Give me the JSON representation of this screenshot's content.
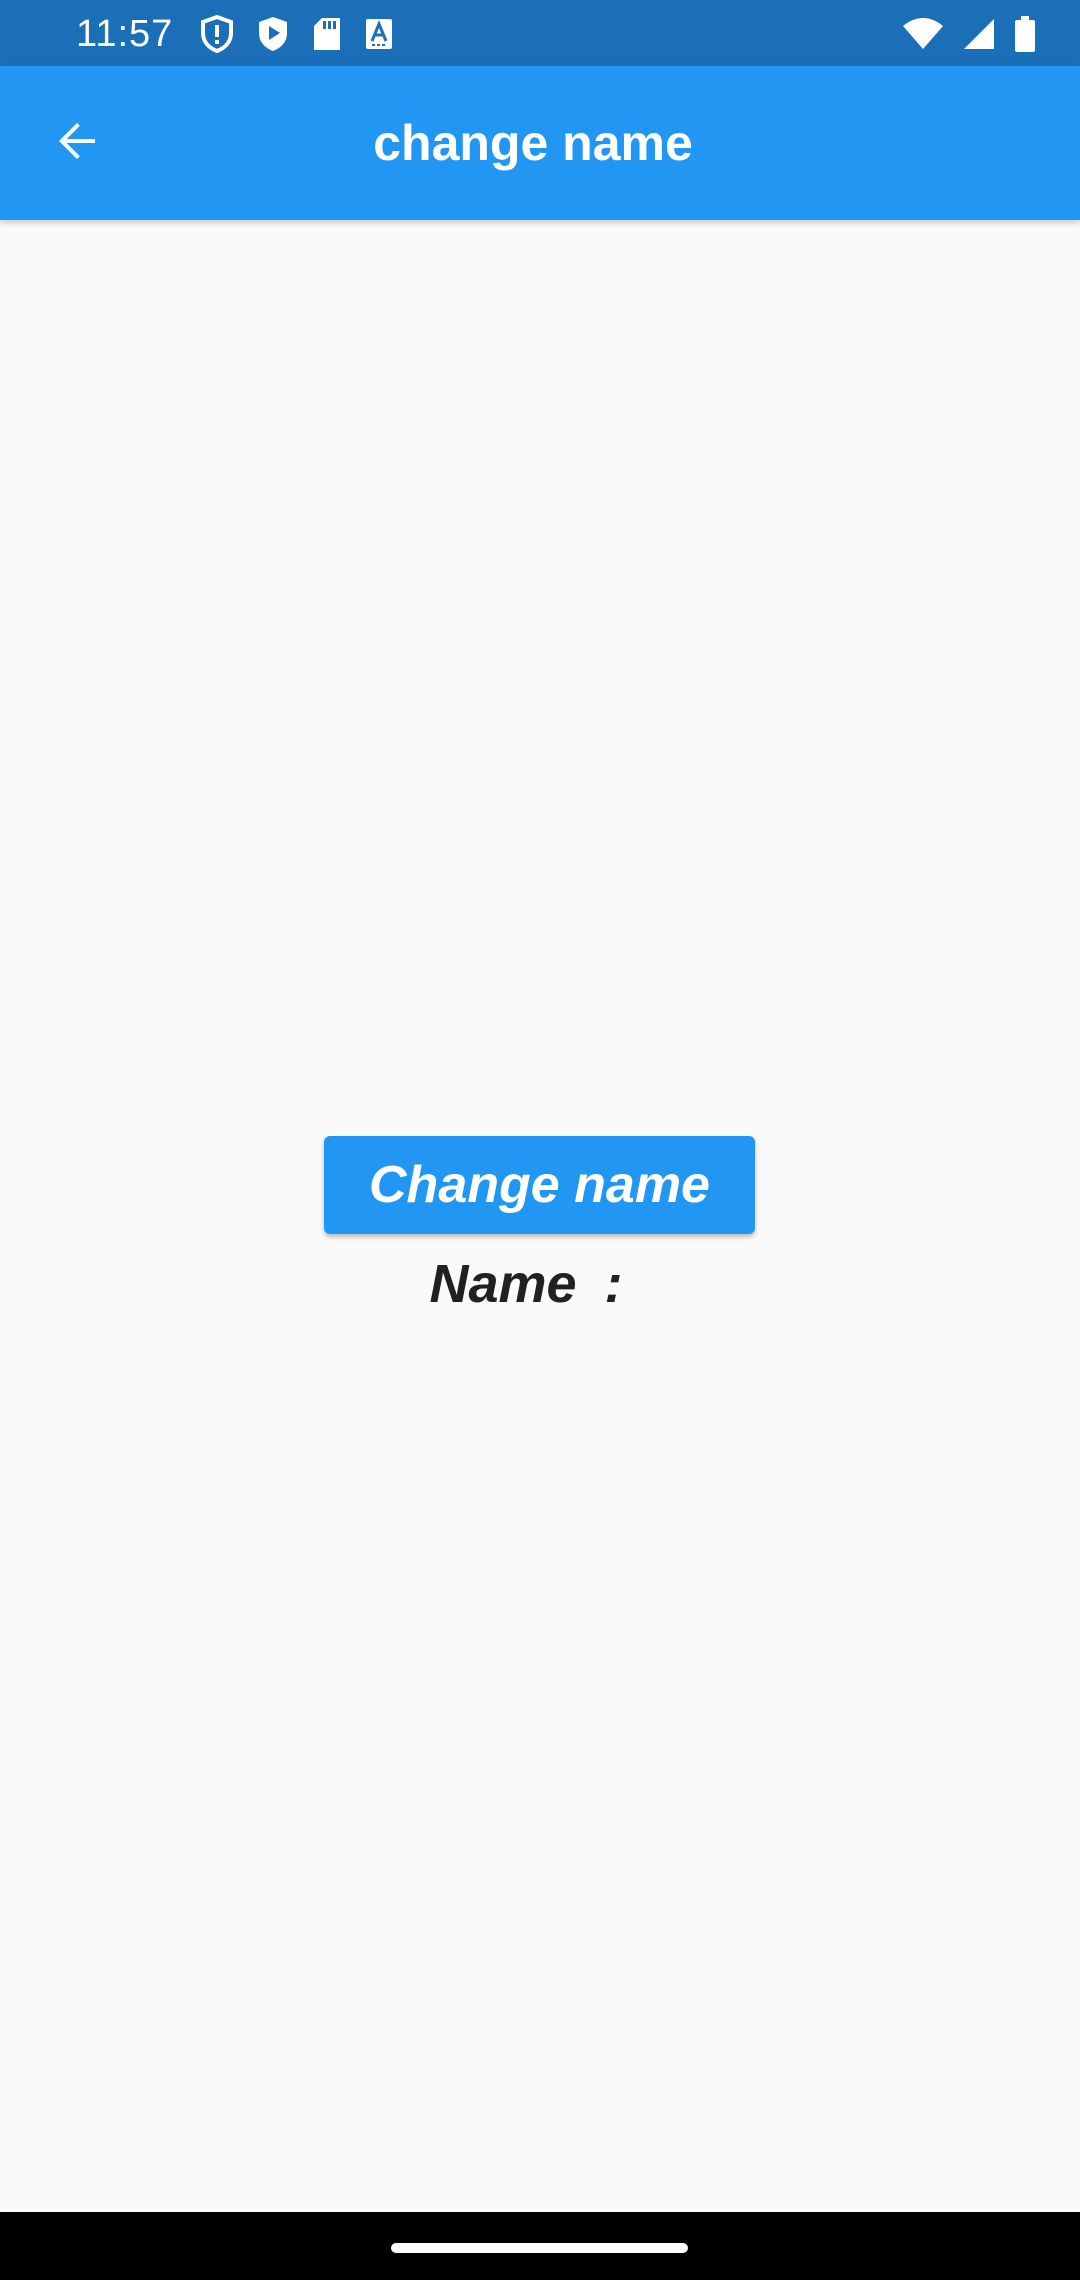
{
  "status_bar": {
    "time": "11:57",
    "left_icons": [
      "shield-alert-icon",
      "play-protect-icon",
      "sd-card-icon",
      "keyboard-a-icon"
    ],
    "right_icons": [
      "wifi-icon",
      "cell-signal-icon",
      "battery-icon"
    ]
  },
  "app_bar": {
    "title": "change name",
    "back_icon": "arrow-back-icon",
    "color": "#2196f3"
  },
  "main": {
    "button_label": "Change name",
    "name_label": "Name",
    "name_separator": ":",
    "name_value": ""
  },
  "colors": {
    "status_bar": "#1b6fb8",
    "accent": "#2196f3",
    "background": "#fafafa",
    "text": "#212121"
  }
}
